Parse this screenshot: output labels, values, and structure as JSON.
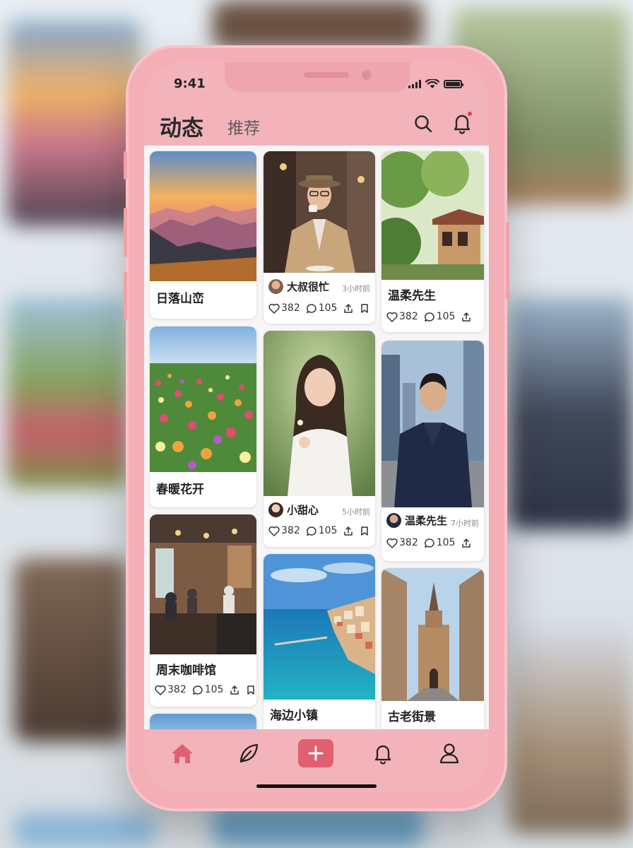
{
  "status_bar": {
    "time": "9:41"
  },
  "header": {
    "title": "动态",
    "tab_recommend": "推荐"
  },
  "colors": {
    "accent": "#e0606f",
    "phone_body": "#f3aeb6",
    "notification_dot": "#e3404d"
  },
  "feed": {
    "col1": [
      {
        "title": "日落山峦",
        "image": "sunset-mountains"
      },
      {
        "title": "春暖花开",
        "image": "flower-field"
      },
      {
        "title": "周末咖啡馆",
        "image": "cafe-interior",
        "likes": "382",
        "comments": "105"
      }
    ],
    "col2": [
      {
        "author": "大叔很忙",
        "time": "3小时前",
        "likes": "382",
        "comments": "105",
        "image": "man-with-coffee"
      },
      {
        "author": "小甜心",
        "time": "5小时前",
        "likes": "382",
        "comments": "105",
        "image": "woman-portrait"
      },
      {
        "title": "海边小镇",
        "image": "seaside-town"
      }
    ],
    "col3": [
      {
        "title": "温柔先生",
        "likes": "382",
        "comments": "105",
        "image": "garden-pavilion"
      },
      {
        "author": "温柔先生",
        "time": "7小时前",
        "likes": "382",
        "comments": "105",
        "image": "businessman-portrait"
      },
      {
        "title": "古老街景",
        "image": "old-street-church"
      }
    ]
  },
  "tabbar": {
    "items": [
      "home-icon",
      "leaf-icon",
      "add-icon",
      "bell-icon",
      "profile-icon"
    ],
    "active": "home-icon"
  }
}
